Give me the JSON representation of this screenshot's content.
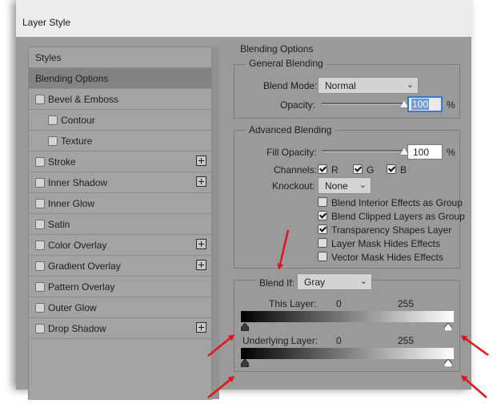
{
  "window": {
    "title": "Layer Style"
  },
  "left_panel": {
    "items": [
      {
        "label": "Styles",
        "checkbox": false,
        "plus": false,
        "selected": false,
        "indent": 0
      },
      {
        "label": "Blending Options",
        "checkbox": false,
        "plus": false,
        "selected": true,
        "indent": 0
      },
      {
        "label": "Bevel & Emboss",
        "checkbox": true,
        "plus": false,
        "selected": false,
        "indent": 0
      },
      {
        "label": "Contour",
        "checkbox": true,
        "plus": false,
        "selected": false,
        "indent": 1
      },
      {
        "label": "Texture",
        "checkbox": true,
        "plus": false,
        "selected": false,
        "indent": 1
      },
      {
        "label": "Stroke",
        "checkbox": true,
        "plus": true,
        "selected": false,
        "indent": 0
      },
      {
        "label": "Inner Shadow",
        "checkbox": true,
        "plus": true,
        "selected": false,
        "indent": 0
      },
      {
        "label": "Inner Glow",
        "checkbox": true,
        "plus": false,
        "selected": false,
        "indent": 0
      },
      {
        "label": "Satin",
        "checkbox": true,
        "plus": false,
        "selected": false,
        "indent": 0
      },
      {
        "label": "Color Overlay",
        "checkbox": true,
        "plus": true,
        "selected": false,
        "indent": 0
      },
      {
        "label": "Gradient Overlay",
        "checkbox": true,
        "plus": true,
        "selected": false,
        "indent": 0
      },
      {
        "label": "Pattern Overlay",
        "checkbox": true,
        "plus": false,
        "selected": false,
        "indent": 0
      },
      {
        "label": "Outer Glow",
        "checkbox": true,
        "plus": false,
        "selected": false,
        "indent": 0
      },
      {
        "label": "Drop Shadow",
        "checkbox": true,
        "plus": true,
        "selected": false,
        "indent": 0
      }
    ]
  },
  "blending": {
    "section_title": "Blending Options",
    "general": {
      "title": "General Blending",
      "blend_mode_label": "Blend Mode:",
      "blend_mode_value": "Normal",
      "opacity_label": "Opacity:",
      "opacity_value": "100",
      "opacity_unit": "%",
      "opacity_level": 1.0
    },
    "advanced": {
      "title": "Advanced Blending",
      "fill_opacity_label": "Fill Opacity:",
      "fill_opacity_value": "100",
      "fill_opacity_unit": "%",
      "fill_opacity_level": 1.0,
      "channels_label": "Channels:",
      "channels": [
        {
          "label": "R",
          "checked": true
        },
        {
          "label": "G",
          "checked": true
        },
        {
          "label": "B",
          "checked": true
        }
      ],
      "knockout_label": "Knockout:",
      "knockout_value": "None",
      "options": [
        {
          "label": "Blend Interior Effects as Group",
          "checked": false
        },
        {
          "label": "Blend Clipped Layers as Group",
          "checked": true
        },
        {
          "label": "Transparency Shapes Layer",
          "checked": true
        },
        {
          "label": "Layer Mask Hides Effects",
          "checked": false
        },
        {
          "label": "Vector Mask Hides Effects",
          "checked": false
        }
      ]
    },
    "blend_if": {
      "label": "Blend If:",
      "value": "Gray",
      "this_layer_label": "This Layer:",
      "this_layer_min": "0",
      "this_layer_max": "255",
      "underlying_label": "Underlying Layer:",
      "underlying_min": "0",
      "underlying_max": "255"
    }
  },
  "colors": {
    "annotation_arrow": "#e0141e",
    "focus_ring": "#3a78c4"
  },
  "icons": {
    "chevron": "chevron-down-icon",
    "plus": "plus-box-icon",
    "arrow": "red-arrow-annotation"
  }
}
